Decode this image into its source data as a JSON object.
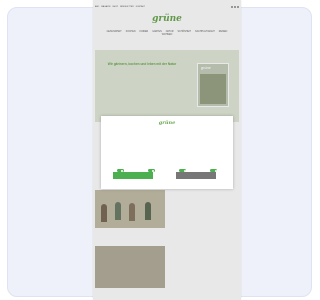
{
  "site": {
    "logo": "grüne",
    "tagline": "",
    "topnav": [
      "ABO",
      "MAGAZIN",
      "SHOP",
      "NEWSLETTER",
      "KONTAKT"
    ],
    "categories": [
      "GESUNDHEIT",
      "KOCHEN",
      "KINDER",
      "GARTEN",
      "NATUR",
      "SCHÖNHEIT",
      "NACHHALTIGKEIT",
      "REISEN",
      "WOHNEN"
    ]
  },
  "banner": {
    "headline": "Wir gärtnern, kochen und leben mit der Natur",
    "subline": "",
    "link": "",
    "magazine_logo": "grüne"
  },
  "articles": [
    {
      "title": ""
    },
    {
      "title": ""
    }
  ],
  "consent": {
    "logo": "grüne",
    "title": "",
    "body": "",
    "toggles": [
      {
        "label": ""
      },
      {
        "label": ""
      },
      {
        "label": ""
      },
      {
        "label": ""
      }
    ],
    "accept_label": "",
    "settings_label": ""
  },
  "colors": {
    "brand_green": "#6aa84f",
    "accept_green": "#4caf50",
    "banner_bg": "#e3ead9",
    "card_bg": "#eef1f9"
  }
}
